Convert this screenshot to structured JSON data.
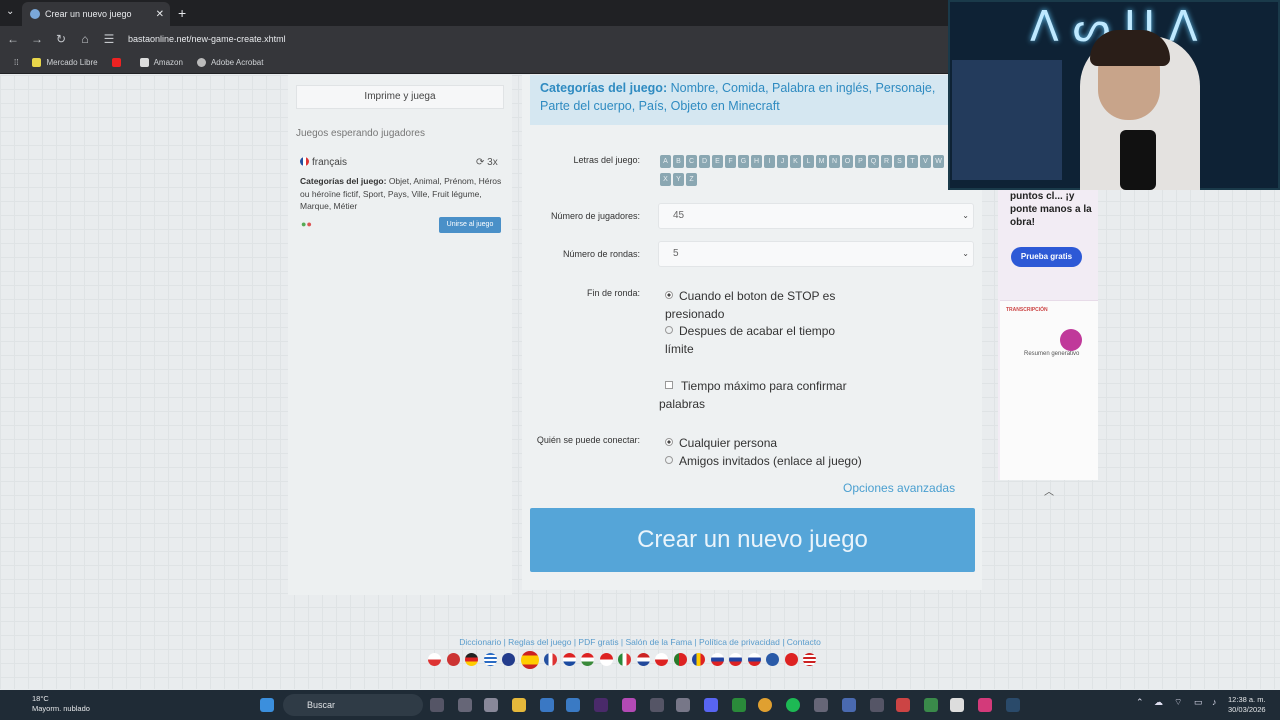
{
  "browser": {
    "tab_title": "Crear un nuevo juego",
    "tab_close": "✕",
    "new_tab": "+",
    "url": "bastaonline.net/new-game-create.xhtml",
    "bookmarks": [
      "Mercado Libre",
      "Amazon",
      "Adobe Acrobat"
    ]
  },
  "left": {
    "print_button": "Imprime y juega",
    "waiting_heading": "Juegos esperando jugadores",
    "game": {
      "language": "français",
      "count": "3x",
      "categories_label": "Categorías del juego:",
      "categories": "Objet, Animal, Prénom, Héros ou héroïne fictif, Sport, Pays, Ville, Fruit légume, Marque, Métier",
      "join_button": "Unirse al juego"
    }
  },
  "form": {
    "categories_label": "Categorías del juego:",
    "categories": "Nombre, Comida, Palabra en inglés, Personaje, Parte del cuerpo, País, Objeto en Minecraft",
    "letters_label": "Letras del juego:",
    "letters": [
      "A",
      "B",
      "C",
      "D",
      "E",
      "F",
      "G",
      "H",
      "I",
      "J",
      "K",
      "L",
      "M",
      "N",
      "O",
      "P",
      "Q",
      "R",
      "S",
      "T",
      "V",
      "W",
      "X",
      "Y",
      "Z"
    ],
    "players_label": "Número de jugadores:",
    "players_value": "45",
    "rounds_label": "Número de rondas:",
    "rounds_value": "5",
    "round_end_label": "Fin de ronda:",
    "round_end_options": [
      "Cuando el boton de STOP es presionado",
      "Despues de acabar el tiempo límite"
    ],
    "round_end_selected": 0,
    "max_time_label": "Tiempo máximo para confirmar palabras",
    "who_label": "Quién se puede conectar:",
    "who_options": [
      "Cualquier persona",
      "Amigos invitados (enlace al juego)"
    ],
    "who_selected": 0,
    "advanced_link": "Opciones avanzadas",
    "create_button": "Crear un nuevo juego"
  },
  "footer": {
    "links": "Diccionario | Reglas del juego | PDF gratis | Salón de la Fama | Política de privacidad | Contacto"
  },
  "ad": {
    "headline": "puntos cl... ¡y ponte manos a la obra!",
    "button": "Prueba gratis",
    "section": "TRANSCRIPCIÓN",
    "summary": "Resumen generativo"
  },
  "taskbar": {
    "weather_temp": "18°C",
    "weather_desc": "Mayorm. nublado",
    "search": "Buscar",
    "time": "12:38 a. m.",
    "date": "30/03/2026"
  },
  "colors": {
    "accent": "#55a5d8",
    "link": "#4a9fd0",
    "category_box": "#d5e7f1"
  }
}
